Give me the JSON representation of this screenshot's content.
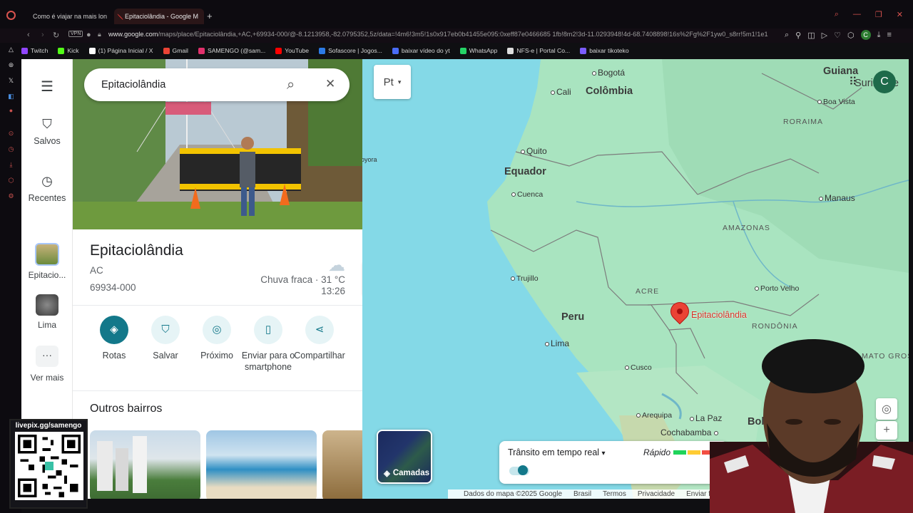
{
  "browser": {
    "tabs": [
      {
        "title": "Como é viajar na mais lon"
      },
      {
        "title": "Epitaciolândia - Google M"
      }
    ],
    "new_tab": "+",
    "vpn_badge": "VPN",
    "url_host": "www.google.com",
    "url_path": "/maps/place/Epitaciolândia,+AC,+69934-000/@-8.1213958,-82.0795352,5z/data=!4m6!3m5!1s0x917eb0b41455e095:0xeff87e0466685 1fb!8m2!3d-11.0293948!4d-68.7408898!16s%2Fg%2F1yw0_s8rr!5m1!1e1",
    "bookmarks": [
      {
        "label": "Twitch",
        "color": "#9146ff"
      },
      {
        "label": "Kick",
        "color": "#53fc18"
      },
      {
        "label": "(1) Página Inicial / X",
        "color": "#ffffff"
      },
      {
        "label": "Gmail",
        "color": "#ea4335"
      },
      {
        "label": "SAMENGO (@sam...",
        "color": "#e1306c"
      },
      {
        "label": "YouTube",
        "color": "#ff0000"
      },
      {
        "label": "Sofascore | Jogos...",
        "color": "#2c7be5"
      },
      {
        "label": "baixar vídeo do yt",
        "color": "#4a6cf7"
      },
      {
        "label": "WhatsApp",
        "color": "#25d366"
      },
      {
        "label": "NFS-e | Portal Co...",
        "color": "#dddddd"
      },
      {
        "label": "baixar tikoteko",
        "color": "#7b5cff"
      }
    ]
  },
  "rail": {
    "menu_icon": "menu-icon",
    "saved": "Salvos",
    "recent": "Recentes",
    "recent_place_1": "Epitacio...",
    "recent_place_2": "Lima",
    "more": "Ver mais",
    "more_glyph": "···"
  },
  "search": {
    "query": "Epitaciolândia"
  },
  "place": {
    "name": "Epitaciolândia",
    "state": "AC",
    "postal": "69934-000",
    "weather_desc": "Chuva fraca · 31 °C",
    "weather_time": "13:26",
    "actions": [
      {
        "label": "Rotas",
        "icon": "directions-icon"
      },
      {
        "label": "Salvar",
        "icon": "bookmark-icon"
      },
      {
        "label": "Próximo",
        "icon": "nearby-icon"
      },
      {
        "label": "Enviar para o smartphone",
        "icon": "phone-icon"
      },
      {
        "label": "Compartilhar",
        "icon": "share-icon"
      }
    ],
    "other_header": "Outros bairros"
  },
  "map": {
    "lang_button": "Pt",
    "avatar_letter": "C",
    "labels": {
      "bogota": "Bogotá",
      "colombia": "Colômbia",
      "cali": "Cali",
      "guiana": "Guiana",
      "suriname": "Suriname",
      "boa_vista": "Boa Vista",
      "roraima": "RORAIMA",
      "quito": "Quito",
      "equador": "Equador",
      "cuenca": "Cuenca",
      "manaus": "Manaus",
      "amazonas": "AMAZONAS",
      "trujillo": "Trujillo",
      "peru": "Peru",
      "acre": "ACRE",
      "epitaciolandia": "Epitaciolândia",
      "porto_velho": "Porto Velho",
      "rondonia": "RONDÔNIA",
      "lima": "Lima",
      "cusco": "Cusco",
      "mato_grosso": "MATO GROS",
      "arequipa": "Arequipa",
      "la_paz": "La Paz",
      "bolivia": "Bolívi",
      "cochabamba": "Cochabamba",
      "joyora": "oyora"
    },
    "layers_label": "Camadas",
    "traffic_label": "Trânsito em tempo real",
    "traffic_fast": "Rápido",
    "footer": [
      "Dados do mapa ©2025 Google",
      "Brasil",
      "Termos",
      "Privacidade",
      "Enviar fe"
    ],
    "zoom_in": "+",
    "zoom_out": "−"
  },
  "overlay": {
    "qr_title": "livepix.gg/samengo"
  },
  "colors": {
    "accent": "#13788a",
    "pin": "#ea4335",
    "land": "#a9e4c0",
    "water": "#84d9e7"
  }
}
